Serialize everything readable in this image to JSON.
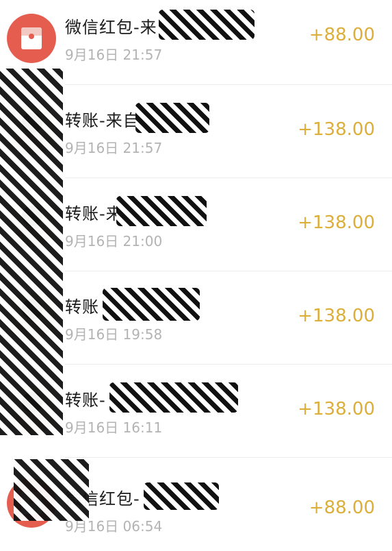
{
  "transactions": [
    {
      "title": "微信红包-来",
      "time": "9月16日 21:57",
      "amount": "+88.00",
      "type": "red-packet"
    },
    {
      "title": "转账-来自",
      "time": "9月16日 21:57",
      "amount": "+138.00",
      "type": "transfer"
    },
    {
      "title": "转账-来自",
      "time": "9月16日 21:00",
      "amount": "+138.00",
      "type": "transfer"
    },
    {
      "title": "转账",
      "time": "9月16日 19:58",
      "amount": "+138.00",
      "type": "transfer"
    },
    {
      "title": "转账-",
      "time": "9月16日 16:11",
      "amount": "+138.00",
      "type": "transfer"
    },
    {
      "title": "微信红包-",
      "time": "9月16日 06:54",
      "amount": "+88.00",
      "type": "red-packet"
    }
  ],
  "colors": {
    "amount": "#dcae3a",
    "red_packet": "#e45d4f",
    "time": "#b3b3b3",
    "title": "#1b1b1b"
  },
  "icons": {
    "red_packet": "red-envelope-icon",
    "person": "avatar-photo"
  }
}
